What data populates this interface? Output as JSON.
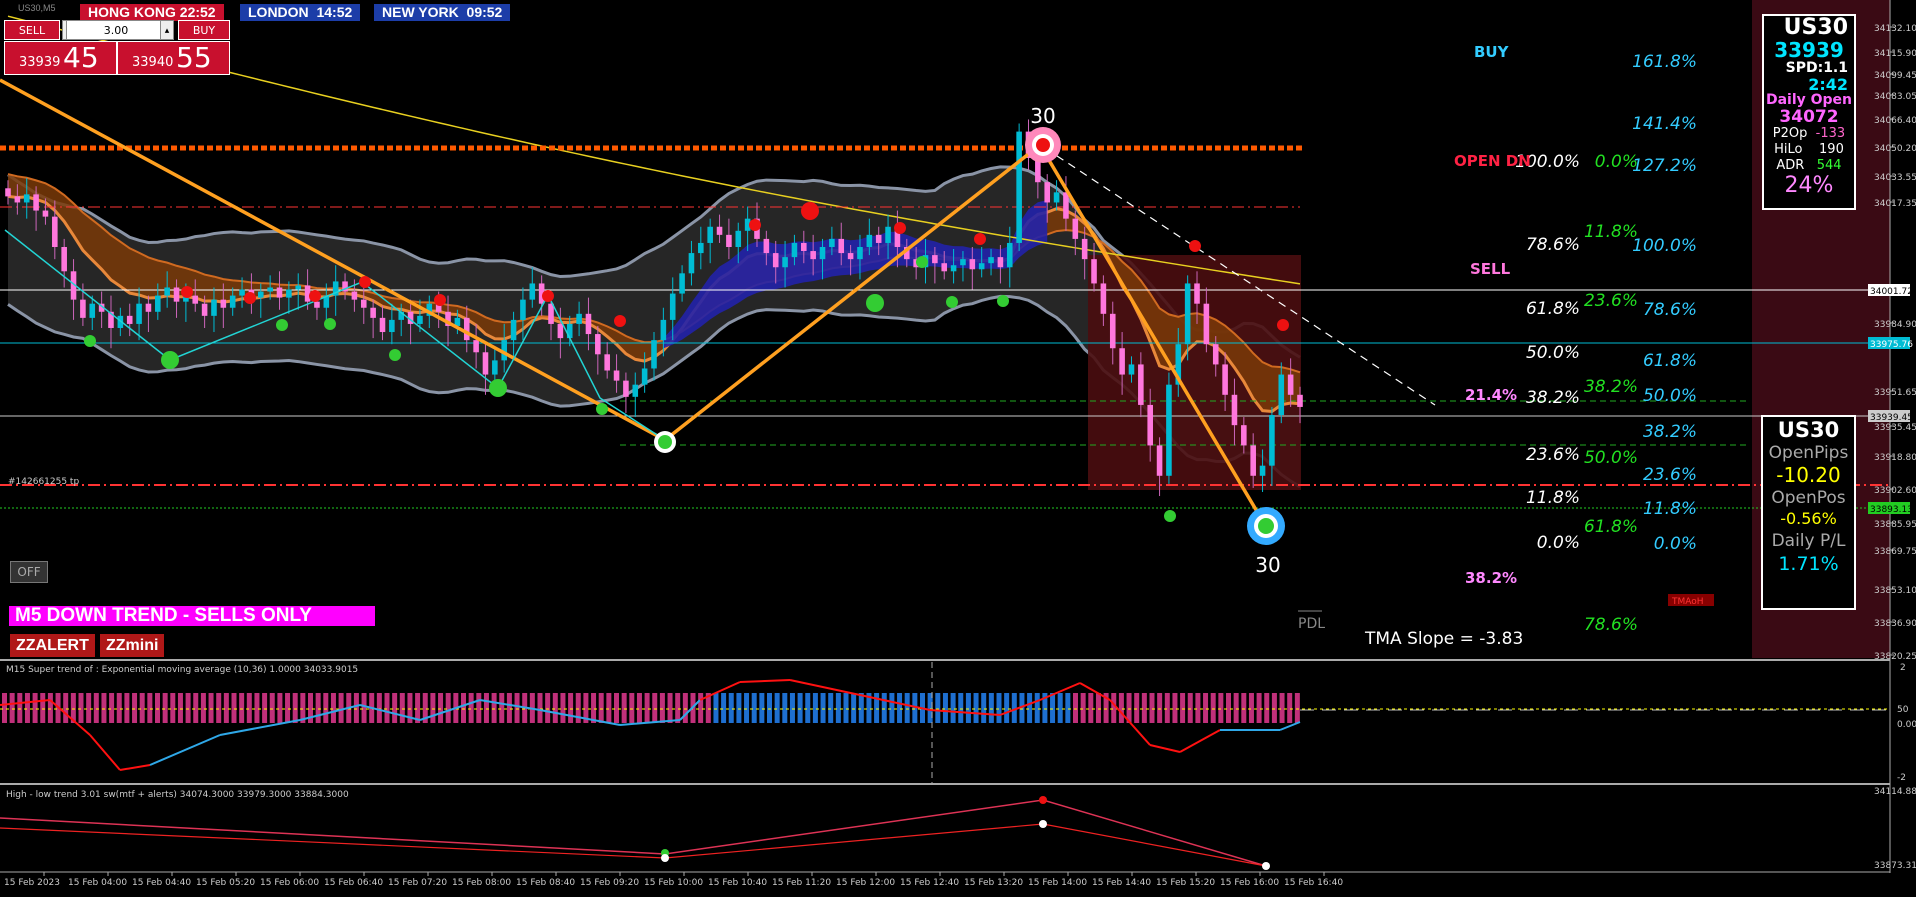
{
  "symbol_label": "US30,M5",
  "clocks": [
    {
      "label": "HONG KONG",
      "time": "22:52",
      "bg": "#c8102e"
    },
    {
      "label": "LONDON",
      "time": "14:52",
      "bg": "#1c3da8"
    },
    {
      "label": "NEW YORK",
      "time": "09:52",
      "bg": "#1c3da8"
    }
  ],
  "trade": {
    "sell_label": "SELL",
    "buy_label": "BUY",
    "lot": "3.00",
    "bid_small": "33939",
    "bid_big": "45",
    "ask_small": "33940",
    "ask_big": "55"
  },
  "info_panel": {
    "symbol": "US30",
    "price": "33939",
    "spread": "SPD:1.1",
    "timer": "2:42",
    "daily_open_label": "Daily Open",
    "daily_open": "34072",
    "rows": [
      {
        "label": "P2Op",
        "value": "-133",
        "color": "#ff66cc"
      },
      {
        "label": "HiLo",
        "value": "190",
        "color": "#ffffff"
      },
      {
        "label": "ADR",
        "value": "544",
        "color": "#33ff33"
      }
    ],
    "pct": "24%"
  },
  "pnl_panel": {
    "symbol": "US30",
    "open_pips_label": "OpenPips",
    "open_pips": "-10.20",
    "open_pos_label": "OpenPos",
    "open_pos": "-0.56%",
    "daily_pl_label": "Daily P/L",
    "daily_pl": "1.71%"
  },
  "trend_banner": "M5  DOWN TREND - SELLS ONLY",
  "buttons": {
    "off": "OFF",
    "zzalert": "ZZALERT",
    "zzmini": "ZZmini"
  },
  "labels": {
    "buy": "BUY",
    "sell": "SELL",
    "open_dn": "OPEN  DN",
    "tma_slope": "TMA Slope = -3.83",
    "pdl": "PDL",
    "zz_top": "30",
    "zz_bottom": "30",
    "fib_212": "21.4%",
    "fib_38b": "38.2%",
    "order_tag": "#142661255 tp",
    "tmah": "TMAoH"
  },
  "fib_columns": {
    "white": [
      "100.0%",
      "78.6%",
      "61.8%",
      "50.0%",
      "38.2%",
      "23.6%",
      "11.8%",
      "0.0%"
    ],
    "green": [
      "0.0%",
      "11.8%",
      "23.6%",
      "38.2%",
      "50.0%",
      "61.8%",
      "78.6%"
    ],
    "cyan": [
      "161.8%",
      "141.4%",
      "127.2%",
      "100.0%",
      "78.6%",
      "61.8%",
      "50.0%",
      "38.2%",
      "23.6%",
      "11.8%",
      "0.0%"
    ]
  },
  "indicators": {
    "sub1_title": "M15  Super trend of : Exponential moving average (10,36)  1.0000 34033.9015",
    "sub2_title": "High - low trend 3.01 sw(mtf + alerts) 34074.3000 33979.3000 33884.3000",
    "sub1_ticks": [
      "2",
      "50",
      "0.00",
      "-2"
    ],
    "sub2_ticks": [
      "34114.8819",
      "33873.3199"
    ]
  },
  "chart_data": {
    "type": "candlestick",
    "price_ticks": [
      "34132.10",
      "34115.90",
      "34099.45",
      "34083.05",
      "34066.40",
      "34050.20",
      "34033.55",
      "34017.35",
      "34001.72",
      "33984.90",
      "33975.76",
      "33951.65",
      "33935.45",
      "33939.45",
      "33918.80",
      "33902.60",
      "33893.13",
      "33885.95",
      "33869.75",
      "33853.10",
      "33836.90",
      "33820.25"
    ],
    "highlighted_ticks": [
      {
        "label": "34001.72",
        "bg": "#ffffff",
        "fg": "#000000"
      },
      {
        "label": "33975.76",
        "bg": "#00bcd4",
        "fg": "#ffffff"
      },
      {
        "label": "33939.45",
        "bg": "#cccccc",
        "fg": "#000000"
      },
      {
        "label": "33893.13",
        "bg": "#22cc22",
        "fg": "#000000"
      }
    ],
    "time_labels": [
      "15 Feb 2023",
      "15 Feb 04:00",
      "15 Feb 04:40",
      "15 Feb 05:20",
      "15 Feb 06:00",
      "15 Feb 06:40",
      "15 Feb 07:20",
      "15 Feb 08:00",
      "15 Feb 08:40",
      "15 Feb 09:20",
      "15 Feb 10:00",
      "15 Feb 10:40",
      "15 Feb 11:20",
      "15 Feb 12:00",
      "15 Feb 12:40",
      "15 Feb 13:20",
      "15 Feb 14:00",
      "15 Feb 14:40",
      "15 Feb 15:20",
      "15 Feb 16:00",
      "15 Feb 16:40"
    ],
    "ylim": [
      33815,
      34140
    ],
    "close": [
      34043,
      34040,
      34044,
      34036,
      34033,
      34018,
      34006,
      33992,
      33983,
      33990,
      33986,
      33978,
      33984,
      33980,
      33990,
      33986,
      33994,
      33998,
      33991,
      33994,
      33990,
      33984,
      33992,
      33988,
      33994,
      33997,
      33993,
      33996,
      33998,
      33993,
      33997,
      33999,
      33991,
      33988,
      33994,
      34001,
      33996,
      33992,
      33988,
      33983,
      33976,
      33982,
      33986,
      33980,
      33984,
      33990,
      33986,
      33979,
      33983,
      33972,
      33966,
      33955,
      33962,
      33972,
      33982,
      33992,
      34000,
      33990,
      33980,
      33973,
      33980,
      33985,
      33975,
      33965,
      33957,
      33952,
      33944,
      33950,
      33958,
      33972,
      33982,
      33995,
      34005,
      34015,
      34020,
      34028,
      34024,
      34018,
      34026,
      34032,
      34022,
      34015,
      34008,
      34013,
      34020,
      34016,
      34012,
      34018,
      34022,
      34015,
      34012,
      34018,
      34024,
      34020,
      34028,
      34018,
      34012,
      34008,
      34014,
      34010,
      34006,
      34009,
      34012,
      34007,
      34010,
      34013,
      34008,
      34020,
      34075,
      34062,
      34050,
      34040,
      34045,
      34032,
      34022,
      34012,
      34000,
      33985,
      33968,
      33955,
      33960,
      33940,
      33920,
      33905,
      33950,
      33970,
      34000,
      33990,
      33970,
      33960,
      33945,
      33930,
      33920,
      33905,
      33910,
      33935,
      33955,
      33945,
      33939
    ]
  }
}
